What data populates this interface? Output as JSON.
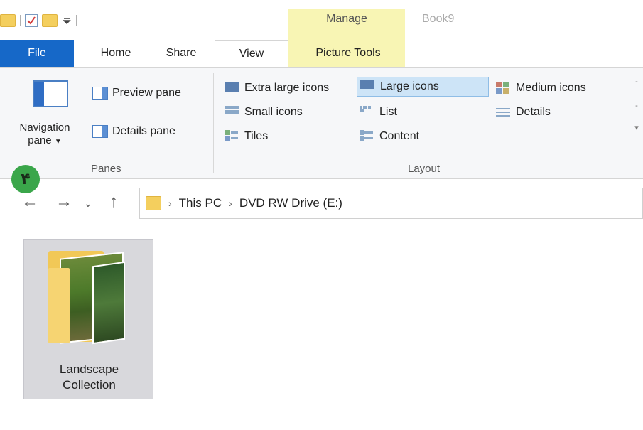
{
  "titlebar": {
    "contextual_tab": "Manage",
    "window_title": "Book9"
  },
  "tabs": [
    {
      "label": "File"
    },
    {
      "label": "Home"
    },
    {
      "label": "Share"
    },
    {
      "label": "View"
    },
    {
      "label": "Picture Tools"
    }
  ],
  "ribbon": {
    "panes": {
      "navigation_pane_line1": "Navigation",
      "navigation_pane_line2": "pane",
      "preview_pane": "Preview pane",
      "details_pane": "Details pane",
      "group_label": "Panes"
    },
    "layout": {
      "items": [
        {
          "label": "Extra large icons",
          "icon": "extra-large-icons-icon"
        },
        {
          "label": "Large icons",
          "icon": "large-icons-icon",
          "selected": true
        },
        {
          "label": "Medium icons",
          "icon": "medium-icons-icon"
        },
        {
          "label": "Small icons",
          "icon": "small-icons-icon"
        },
        {
          "label": "List",
          "icon": "list-icon"
        },
        {
          "label": "Details",
          "icon": "details-icon"
        },
        {
          "label": "Tiles",
          "icon": "tiles-icon"
        },
        {
          "label": "Content",
          "icon": "content-icon"
        }
      ],
      "group_label": "Layout"
    }
  },
  "badge": {
    "text": "۴",
    "color": "#3aa64a"
  },
  "address": {
    "crumbs": [
      "This PC",
      "DVD RW Drive (E:)"
    ]
  },
  "content": {
    "items": [
      {
        "line1": "Landscape",
        "line2": "Collection",
        "selected": true
      }
    ]
  },
  "colors": {
    "file_tab": "#1668c8",
    "manage_tab": "#f8f5b4",
    "selection": "#cde4f7"
  }
}
